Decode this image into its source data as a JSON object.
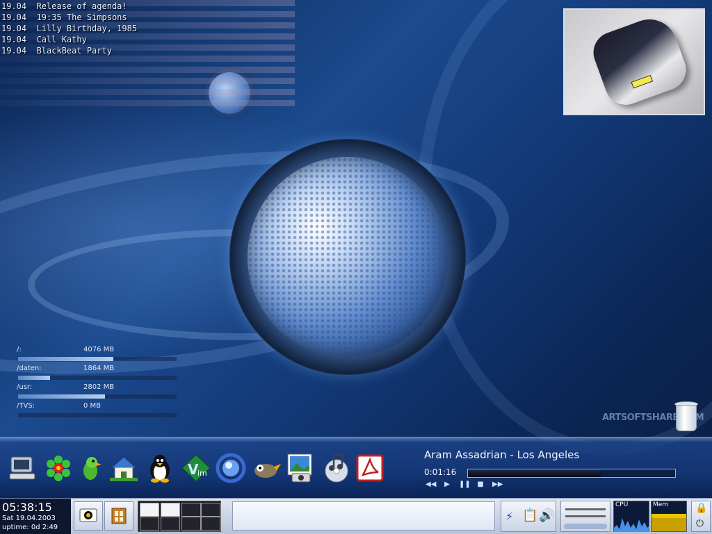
{
  "agenda": [
    {
      "date": "19.04",
      "text": "Release of agenda!"
    },
    {
      "date": "19.04",
      "text": "19:35 The Simpsons"
    },
    {
      "date": "19.04",
      "text": "Lilly Birthday, 1985"
    },
    {
      "date": "19.04",
      "text": "Call Kathy"
    },
    {
      "date": "19.04",
      "text": "BlackBeat Party"
    }
  ],
  "filesystems": [
    {
      "mount": "/:",
      "size": "4076 MB",
      "fill": 0.6
    },
    {
      "mount": "/daten:",
      "size": "1864 MB",
      "fill": 0.2
    },
    {
      "mount": "/usr:",
      "size": "2802 MB",
      "fill": 0.55
    },
    {
      "mount": "/TVS:",
      "size": "0 MB",
      "fill": 0.0
    }
  ],
  "watermark": "ARTSOFTSHARE.COM",
  "dock": {
    "icons": [
      "computer-icon",
      "icq-flower-icon",
      "chat-parrot-icon",
      "home-icon",
      "tux-penguin-icon",
      "vim-icon",
      "browser-globe-icon",
      "gimp-icon",
      "image-viewer-icon",
      "music-player-icon",
      "acrobat-reader-icon"
    ]
  },
  "now_playing": {
    "title": "Aram Assadrian - Los Angeles",
    "elapsed": "0:01:16",
    "progress": 0.64
  },
  "panel": {
    "clock_time": "05:38:15",
    "clock_date": "Sat 19.04.2003",
    "uptime": "uptime: 0d 2:49",
    "cpu_label": "CPU",
    "mem_label": "Mem"
  }
}
